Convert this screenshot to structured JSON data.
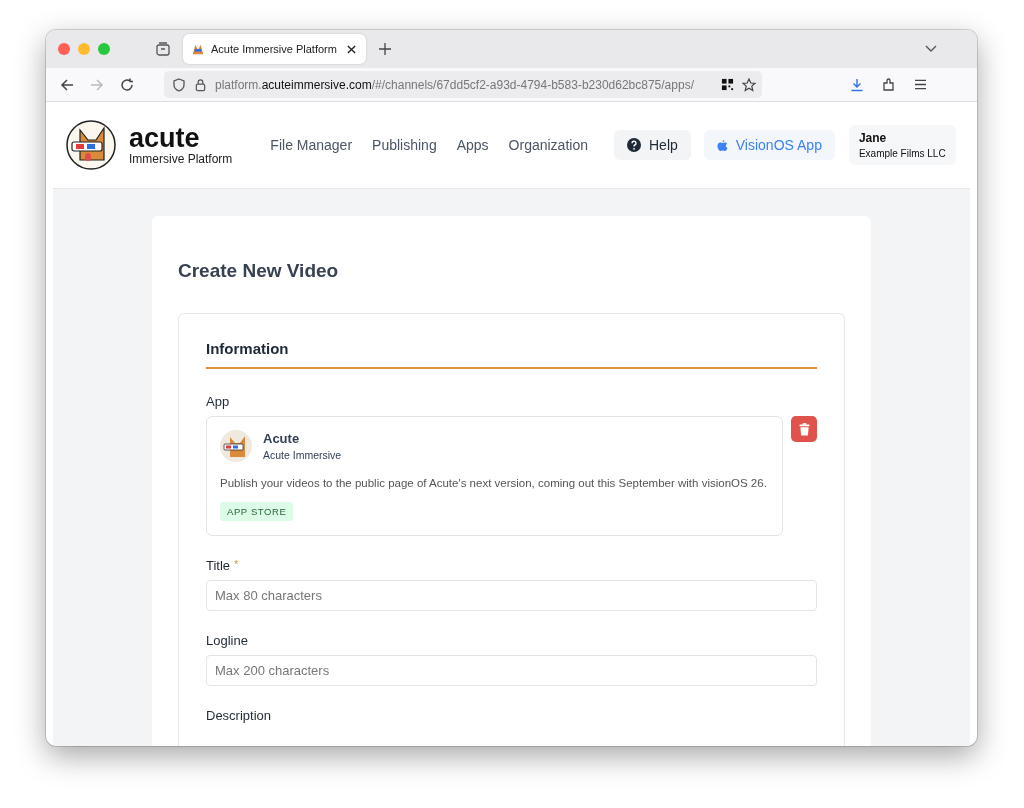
{
  "browser": {
    "tab_title": "Acute Immersive Platform",
    "url": {
      "prefix": "platform.",
      "domain": "acuteimmersive.com",
      "path": "/#/channels/67dd5cf2-a93d-4794-b583-b230d62bc875/apps/"
    }
  },
  "header": {
    "brand": "acute",
    "tagline": "Immersive Platform",
    "nav": [
      "File Manager",
      "Publishing",
      "Apps",
      "Organization"
    ],
    "help_button": "Help",
    "visionos_button": "VisionOS App",
    "user": {
      "name": "Jane",
      "organization": "Example Films LLC"
    }
  },
  "page_title": "Create New Video",
  "section": {
    "title": "Information",
    "app_label": "App",
    "app": {
      "name": "Acute",
      "publisher": "Acute Immersive",
      "description": "Publish your videos to the public page of Acute's next version, coming out this September with visionOS 26.",
      "tag": "APP STORE"
    },
    "fields": [
      {
        "kind": "input",
        "label": "Title",
        "required_mark": "*",
        "placeholder": "Max 80 characters"
      },
      {
        "kind": "input",
        "label": "Logline",
        "placeholder": "Max 200 characters"
      },
      {
        "kind": "label",
        "label": "Description"
      }
    ]
  }
}
